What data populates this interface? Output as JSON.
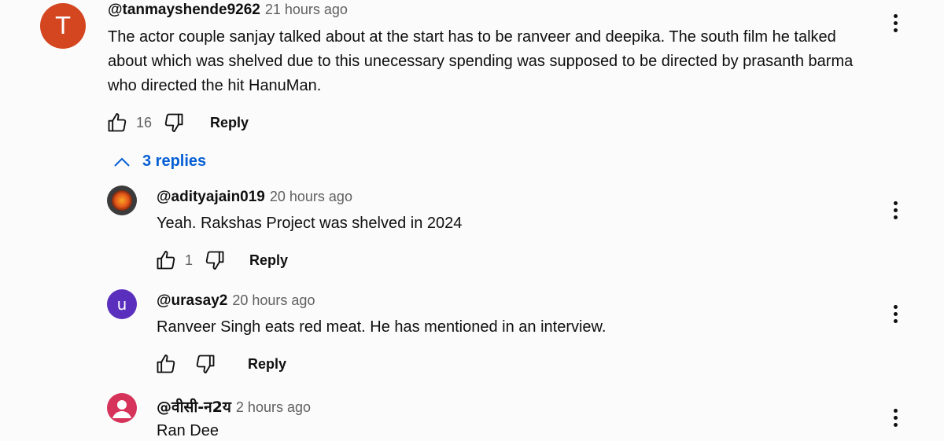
{
  "main_comment": {
    "avatar_letter": "T",
    "author": "@tanmayshende9262",
    "time": "21 hours ago",
    "text": "The actor couple sanjay talked about at the start has to be ranveer and deepika. The south film he talked about which was shelved due to this unecessary spending was supposed to be directed by prasanth barma who directed the hit HanuMan.",
    "likes": "16",
    "reply_label": "Reply"
  },
  "replies_toggle": {
    "label": "3 replies"
  },
  "replies": [
    {
      "author": "@adityajain019",
      "time": "20 hours ago",
      "text": "Yeah. Rakshas Project was shelved in 2024",
      "likes": "1",
      "reply_label": "Reply"
    },
    {
      "avatar_letter": "u",
      "author": "@urasay2",
      "time": "20 hours ago",
      "text": "Ranveer Singh eats red meat. He has mentioned in an interview.",
      "reply_label": "Reply"
    },
    {
      "author": "@वीसी-न2य",
      "time": "2 hours ago",
      "text": "Ran Dee"
    }
  ],
  "colors": {
    "main_avatar": "#d3461f",
    "urasay_avatar": "#5b2fbd",
    "vc_avatar": "#d6335b",
    "link_blue": "#065fd4"
  }
}
